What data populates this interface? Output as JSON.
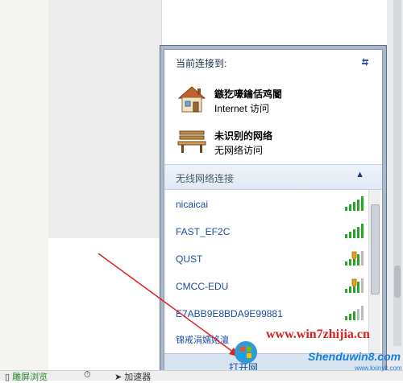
{
  "flyout": {
    "header": "当前连接到:",
    "connected": [
      {
        "name": "鏃犵嚎鑰佸鸡閽",
        "status": "Internet 访问",
        "icon": "house-icon"
      },
      {
        "name": "未识别的网络",
        "status": "无网络访问",
        "icon": "bench-icon"
      }
    ],
    "wireless_section": "无线网络连接",
    "networks": [
      {
        "ssid": "nicaicai",
        "signal": 5,
        "secured": false
      },
      {
        "ssid": "FAST_EF2C",
        "signal": 5,
        "secured": false
      },
      {
        "ssid": "QUST",
        "signal": 4,
        "secured": true
      },
      {
        "ssid": "CMCC-EDU",
        "signal": 4,
        "secured": true
      },
      {
        "ssid": "E7ABB9E8BDA9E99881",
        "signal": 3,
        "secured": false
      },
      {
        "ssid": "锦戒涓嬬姳澶",
        "signal": 3,
        "secured": false
      }
    ],
    "footer_link": "打开网"
  },
  "taskbar": {
    "items": [
      "雕屏浏览",
      "加速器"
    ]
  },
  "watermark": {
    "url": "www.win7zhijia.cn",
    "brand": "Shenduwin8.com",
    "site": "www.kxinyk.com"
  },
  "colors": {
    "accent": "#1d4da3",
    "arrow": "#e02020",
    "signal": "#2aa52a"
  }
}
